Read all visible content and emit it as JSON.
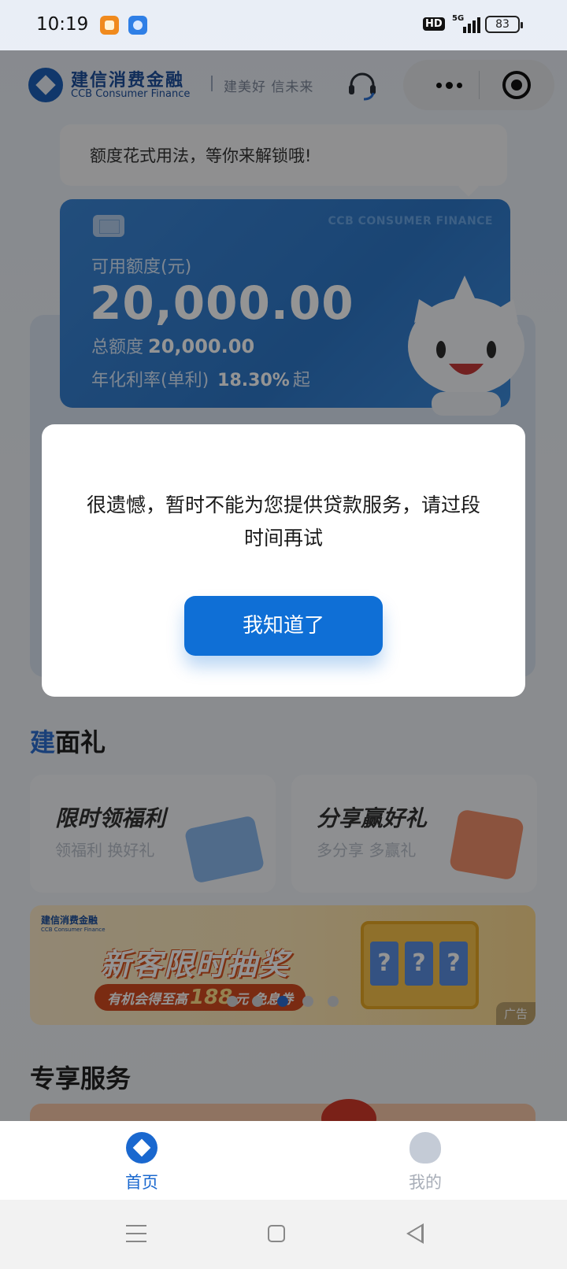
{
  "status_bar": {
    "time": "10:19",
    "hd": "HD",
    "network": "5G",
    "battery": "83"
  },
  "header": {
    "brand_cn": "建信消费金融",
    "brand_en": "CCB Consumer Finance",
    "slogan": "建美好 信未来"
  },
  "tip": {
    "text": "额度花式用法，等你来解锁哦!"
  },
  "card": {
    "watermark": "CCB CONSUMER FINANCE",
    "available_label": "可用额度(元)",
    "available_amount": "20,000.00",
    "total_label": "总额度",
    "total_amount": "20,000.00",
    "rate_label": "年化利率(单利)",
    "rate_value": "18.30%",
    "rate_suffix": "起"
  },
  "benefits": {
    "title_accent": "建",
    "title_rest": "面礼",
    "items": [
      {
        "title": "限时领福利",
        "subtitle": "领福利 换好礼"
      },
      {
        "title": "分享赢好礼",
        "subtitle": "多分享 多赢礼"
      }
    ]
  },
  "banner": {
    "logo_cn": "建信消费金融",
    "logo_en": "CCB Consumer Finance",
    "headline": "新客限时抽奖",
    "pill_prefix": "有机会得至高",
    "pill_amount": "188",
    "pill_suffix": "元 免息券",
    "slot_chars": [
      "?",
      "?",
      "?"
    ],
    "ad_label": "广告",
    "carousel_active_index": 2,
    "carousel_count": 5
  },
  "services": {
    "title": "专享服务"
  },
  "dialog": {
    "message": "很遗憾，暂时不能为您提供贷款服务，请过段时间再试",
    "confirm_label": "我知道了"
  },
  "tabbar": {
    "home_label": "首页",
    "mine_label": "我的",
    "active": "home"
  },
  "colors": {
    "brand_blue": "#1a68cf",
    "button_blue": "#0f6fd6",
    "card_blue": "#2e77c8"
  },
  "icons": {
    "header_support": "headset-icon",
    "capsule_more": "more-dots-icon",
    "capsule_close": "target-circle-icon",
    "tab_home": "ccb-logo-icon",
    "tab_mine": "mascot-icon"
  }
}
